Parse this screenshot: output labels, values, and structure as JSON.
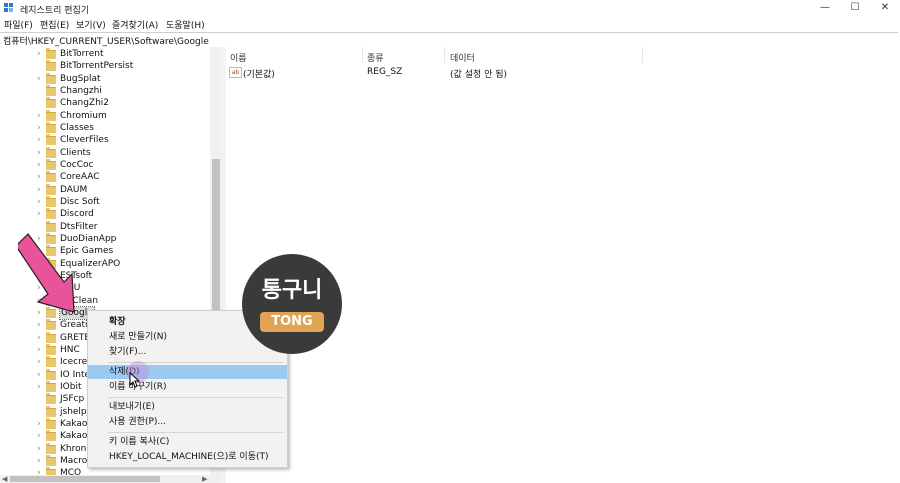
{
  "window": {
    "title": "레지스트리 편집기",
    "minimize_glyph": "—",
    "maximize_glyph": "☐",
    "close_glyph": "✕"
  },
  "menu": [
    "파일(F)",
    "편집(E)",
    "보기(V)",
    "즐겨찾기(A)",
    "도움말(H)"
  ],
  "address": "컴퓨터\\HKEY_CURRENT_USER\\Software\\Google",
  "tree": {
    "items": [
      "BitTorrent",
      "BitTorrentPersist",
      "BugSplat",
      "Changzhi",
      "ChangZhi2",
      "Chromium",
      "Classes",
      "CleverFiles",
      "Clients",
      "CocCoc",
      "CoreAAC",
      "DAUM",
      "Disc Soft",
      "Discord",
      "DtsFilter",
      "DuoDianApp",
      "Epic Games",
      "EqualizerAPO",
      "ESTsoft",
      "GNU",
      "GoClean",
      "Google",
      "Greatis",
      "GRETECH",
      "HNC",
      "Icecream",
      "IO Interactive",
      "IObit",
      "JSFcp",
      "jshelp_",
      "Kakao",
      "KakaoTalk",
      "Khronos",
      "Macromedia",
      "MCO"
    ],
    "selected": "Google"
  },
  "list": {
    "headers": {
      "name": "이름",
      "type": "종류",
      "data": "데이터"
    },
    "rows": [
      {
        "icon": "string-value-icon",
        "icon_text": "ab",
        "name": "(기본값)",
        "type": "REG_SZ",
        "data": "(값 설정 안 됨)"
      }
    ]
  },
  "context_menu": {
    "items": [
      {
        "label": "확장",
        "bold": true
      },
      {
        "label": "새로 만들기(N)",
        "submenu": true,
        "arrow": "›"
      },
      {
        "label": "찾기(F)..."
      },
      {
        "label": "삭제(D)",
        "highlight": true
      },
      {
        "label": "이름 바꾸기(R)"
      },
      {
        "label": "내보내기(E)"
      },
      {
        "label": "사용 권한(P)..."
      },
      {
        "label": "키 이름 복사(C)"
      },
      {
        "label": "HKEY_LOCAL_MACHINE(으)로 이동(T)"
      }
    ]
  },
  "watermark": {
    "text": "통구니",
    "badge": "TONG"
  },
  "colors": {
    "highlight": "#9cc9f0",
    "folder": "#e9c66a",
    "annotation_arrow": "#e8539a"
  }
}
